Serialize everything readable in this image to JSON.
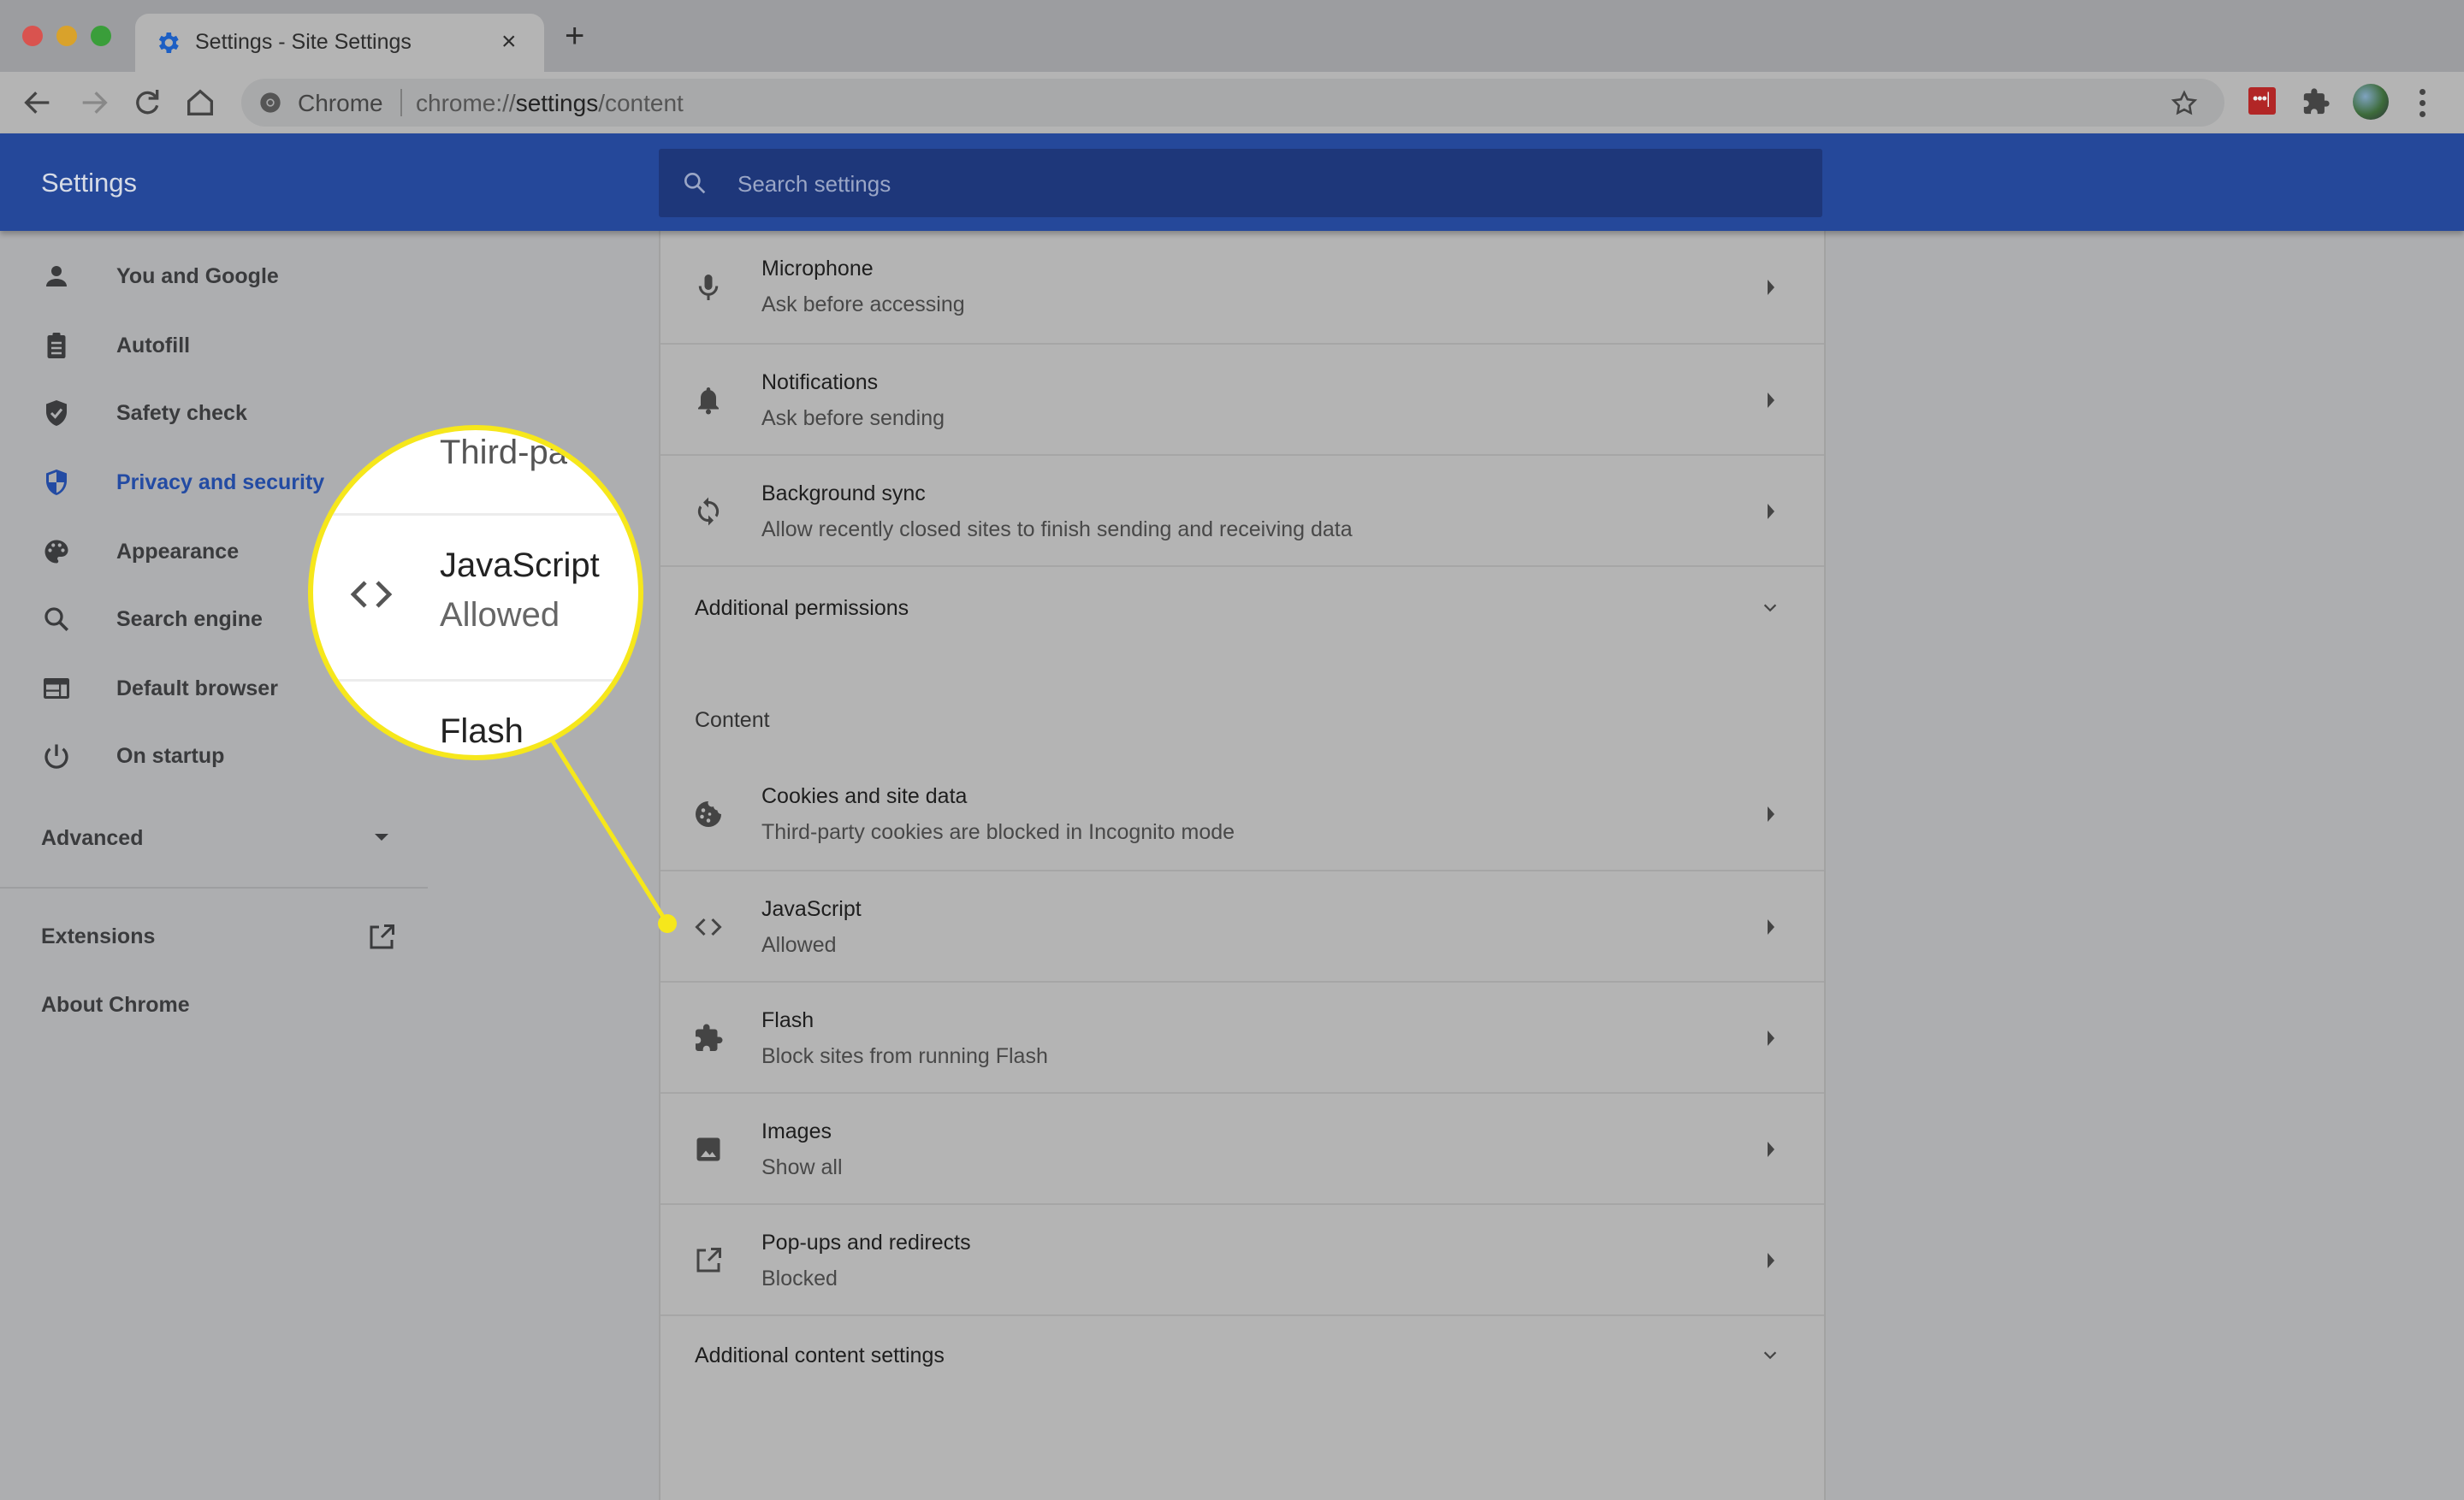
{
  "browser": {
    "tab_title": "Settings - Site Settings",
    "new_tab_label": "+",
    "close_tab_label": "×",
    "omnibox": {
      "site_label": "Chrome",
      "url_prefix": "chrome://",
      "url_host": "settings",
      "url_path": "/content"
    },
    "colors": {
      "traffic_red": "#d9534f",
      "traffic_yellow": "#d9a22b",
      "traffic_green": "#3a9e3a",
      "lastpass_red": "#b22626"
    }
  },
  "header": {
    "title": "Settings",
    "search_placeholder": "Search settings",
    "color": "#25489a"
  },
  "sidebar": {
    "items": [
      {
        "label": "You and Google",
        "icon": "person-icon",
        "active": false
      },
      {
        "label": "Autofill",
        "icon": "clipboard-icon",
        "active": false
      },
      {
        "label": "Safety check",
        "icon": "shield-check-icon",
        "active": false
      },
      {
        "label": "Privacy and security",
        "icon": "shield-half-icon",
        "active": true
      },
      {
        "label": "Appearance",
        "icon": "palette-icon",
        "active": false
      },
      {
        "label": "Search engine",
        "icon": "search-icon",
        "active": false
      },
      {
        "label": "Default browser",
        "icon": "browser-window-icon",
        "active": false
      },
      {
        "label": "On startup",
        "icon": "power-icon",
        "active": false
      }
    ],
    "advanced_label": "Advanced",
    "extensions_label": "Extensions",
    "about_label": "About Chrome",
    "active_color": "#234ba3"
  },
  "content": {
    "permissions": [
      {
        "title": "Microphone",
        "subtitle": "Ask before accessing",
        "icon": "microphone-icon"
      },
      {
        "title": "Notifications",
        "subtitle": "Ask before sending",
        "icon": "bell-icon"
      },
      {
        "title": "Background sync",
        "subtitle": "Allow recently closed sites to finish sending and receiving data",
        "icon": "sync-icon"
      }
    ],
    "additional_permissions_label": "Additional permissions",
    "content_section_label": "Content",
    "content_items": [
      {
        "title": "Cookies and site data",
        "subtitle": "Third-party cookies are blocked in Incognito mode",
        "icon": "cookie-icon"
      },
      {
        "title": "JavaScript",
        "subtitle": "Allowed",
        "icon": "code-icon"
      },
      {
        "title": "Flash",
        "subtitle": "Block sites from running Flash",
        "icon": "puzzle-icon"
      },
      {
        "title": "Images",
        "subtitle": "Show all",
        "icon": "image-icon"
      },
      {
        "title": "Pop-ups and redirects",
        "subtitle": "Blocked",
        "icon": "open-in-new-icon"
      }
    ],
    "additional_content_label": "Additional content settings"
  },
  "magnifier": {
    "top_text": "Third-pa",
    "title": "JavaScript",
    "subtitle": "Allowed",
    "bottom_text": "Flash",
    "highlight_color": "#f6e71b"
  }
}
